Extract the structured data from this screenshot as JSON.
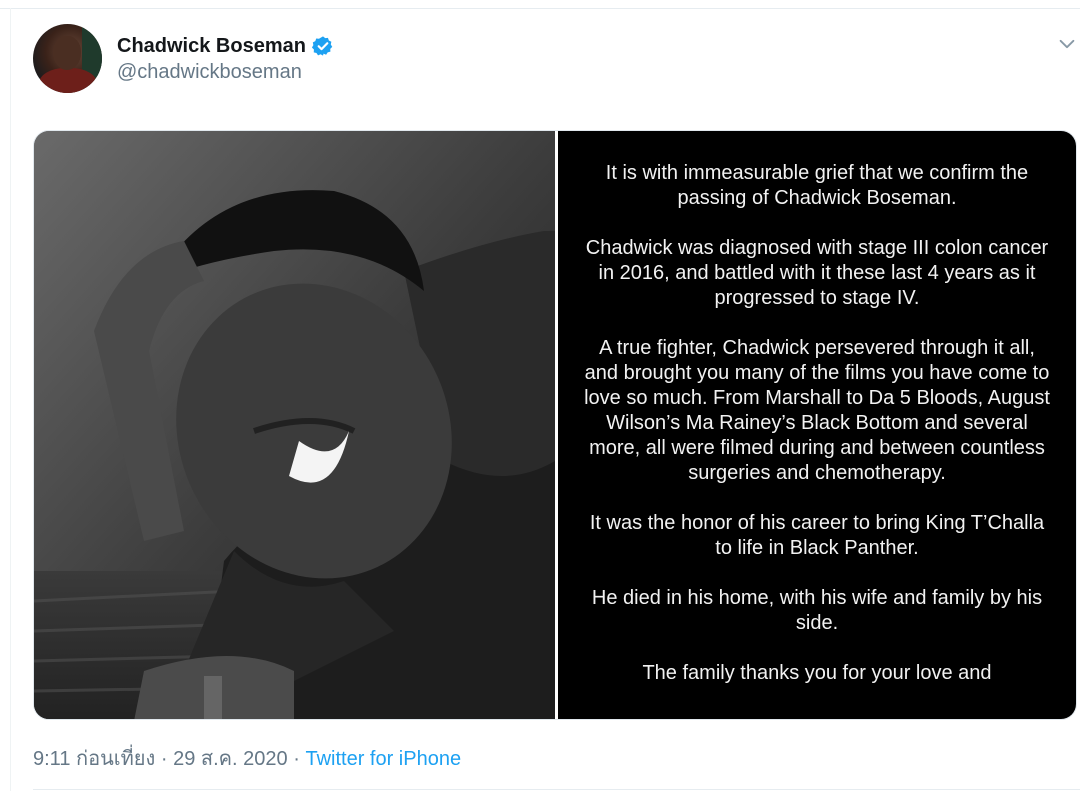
{
  "tweet": {
    "author": {
      "display_name": "Chadwick Boseman",
      "handle": "@chadwickboseman",
      "verified": true,
      "avatar_icon": "avatar-photo",
      "verified_icon": "verified-badge-icon"
    },
    "menu_icon": "chevron-down-icon",
    "statement_paragraphs": [
      "It is with immeasurable grief that we confirm the passing of Chadwick Boseman.",
      "Chadwick was diagnosed with stage III colon cancer in 2016, and battled with it these last 4 years as it progressed to stage IV.",
      "A true fighter, Chadwick persevered through it all, and brought you many of the films you have come to love so much. From Marshall to Da 5 Bloods, August Wilson’s Ma Rainey’s Black Bottom and several more, all were filmed during and between countless surgeries and chemotherapy.",
      "It was the honor of his career to bring King T’Challa to life in Black Panther.",
      "He died in his home, with his wife and family by his side.",
      "The family thanks you for your love and"
    ],
    "time": "9:11 ก่อนเที่ยง",
    "date": "29 ส.ค. 2020",
    "separator": "·",
    "source": "Twitter for iPhone"
  },
  "colors": {
    "text_primary": "#14171a",
    "text_secondary": "#657786",
    "link": "#1da1f2",
    "verified": "#1da1f2",
    "statement_bg": "#000000",
    "statement_text": "#f2f2f2"
  }
}
